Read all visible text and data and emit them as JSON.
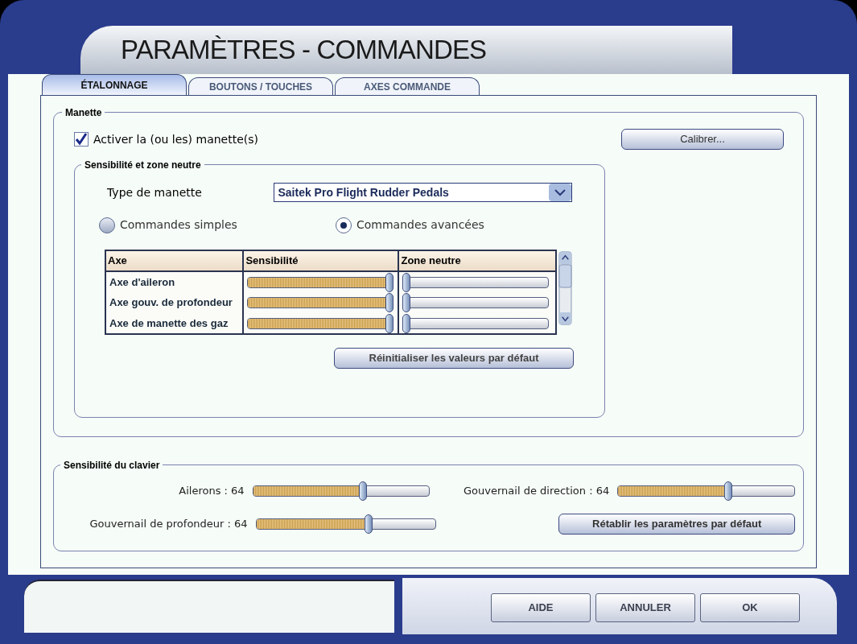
{
  "window": {
    "title": "PARAMÈTRES - COMMANDES"
  },
  "tabs": [
    {
      "label": "ÉTALONNAGE",
      "selected": true
    },
    {
      "label": "BOUTONS / TOUCHES",
      "selected": false
    },
    {
      "label": "AXES COMMANDE",
      "selected": false
    }
  ],
  "manette": {
    "legend": "Manette",
    "enable": {
      "label": "Activer la (ou les) manette(s)",
      "checked": true
    },
    "calibrate_button": "Calibrer..."
  },
  "sensitivity": {
    "legend": "Sensibilité et zone neutre",
    "type_label": "Type de manette",
    "type_value": "Saitek Pro Flight Rudder Pedals",
    "modes": [
      {
        "label": "Commandes simples",
        "selected": false
      },
      {
        "label": "Commandes avancées",
        "selected": true
      }
    ],
    "table": {
      "columns": [
        "Axe",
        "Sensibilité",
        "Zone neutre"
      ],
      "rows": [
        {
          "axis": "Axe d'aileron",
          "sensitivity": {
            "level": 1
          },
          "dead_zone": {
            "level": 0
          }
        },
        {
          "axis": "Axe gouv. de profondeur",
          "sensitivity": {
            "level": 1
          },
          "dead_zone": {
            "level": 0
          }
        },
        {
          "axis": "Axe de manette des gaz",
          "sensitivity": {
            "level": 1
          },
          "dead_zone": {
            "level": 0
          }
        }
      ]
    },
    "reset_button": "Réinitialiser les valeurs par défaut"
  },
  "keyboard": {
    "legend": "Sensibilité du clavier",
    "sliders": [
      {
        "label": "Ailerons : 64",
        "level": 0.63
      },
      {
        "label": "Gouvernail de direction : 64",
        "level": 0.63
      },
      {
        "label": "Gouvernail de profondeur : 64",
        "level": 0.63
      }
    ],
    "reset_button": "Rétablir les paramètres par défaut"
  },
  "buttons": [
    "AIDE",
    "ANNULER",
    "OK"
  ]
}
